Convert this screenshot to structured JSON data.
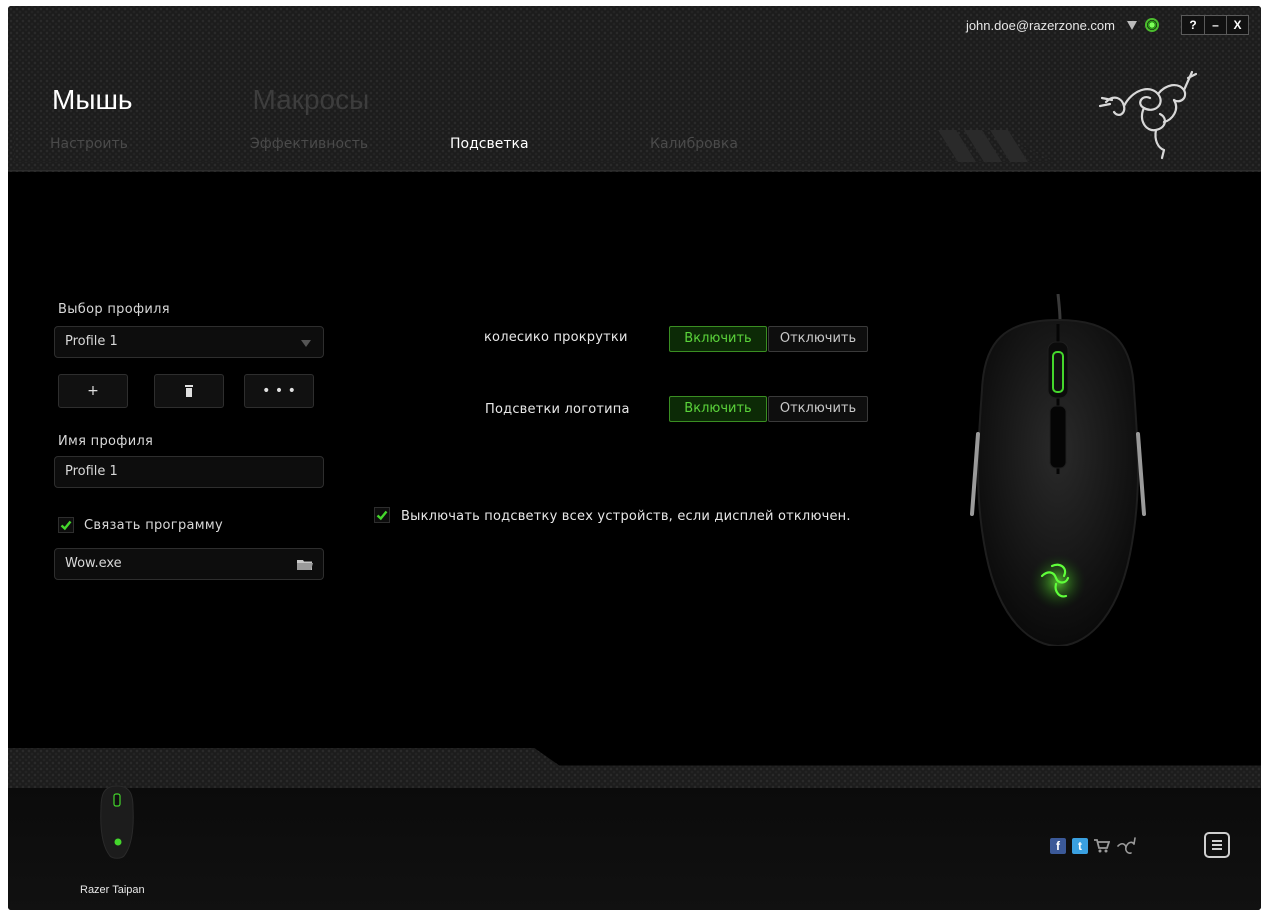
{
  "window": {
    "account": "john.doe@razerzone.com",
    "buttons": {
      "help": "?",
      "minimize": "–",
      "close": "X"
    }
  },
  "main_nav": [
    {
      "label": "Мышь",
      "active": true
    },
    {
      "label": "Макросы",
      "active": false
    }
  ],
  "sub_nav": [
    {
      "label": "Настроить",
      "active": false
    },
    {
      "label": "Эффективность",
      "active": false
    },
    {
      "label": "Подсветка",
      "active": true
    },
    {
      "label": "Калибровка",
      "active": false
    }
  ],
  "profile": {
    "select_label": "Выбор профиля",
    "selected": "Profile 1",
    "add_label": "+",
    "delete_icon": "trash-icon",
    "more_label": "• • •",
    "name_label": "Имя профиля",
    "name_value": "Profile 1",
    "link_program_label": "Связать программу",
    "link_program_checked": true,
    "program_value": "Wow.exe"
  },
  "lighting": {
    "scroll_wheel": {
      "label": "колесико прокрутки",
      "on": "Включить",
      "off": "Отключить",
      "state": "on"
    },
    "logo": {
      "label": "Подсветки логотипа",
      "on": "Включить",
      "off": "Отключить",
      "state": "on"
    },
    "display_off": {
      "label": "Выключать подсветку всех устройств, если дисплей отключен.",
      "checked": true
    }
  },
  "footer": {
    "device_name": "Razer Taipan",
    "icons": [
      "facebook-icon",
      "twitter-icon",
      "cart-icon",
      "razer-logo-icon",
      "menu-icon"
    ]
  },
  "colors": {
    "accent_green": "#44d62c",
    "background": "#000000"
  }
}
